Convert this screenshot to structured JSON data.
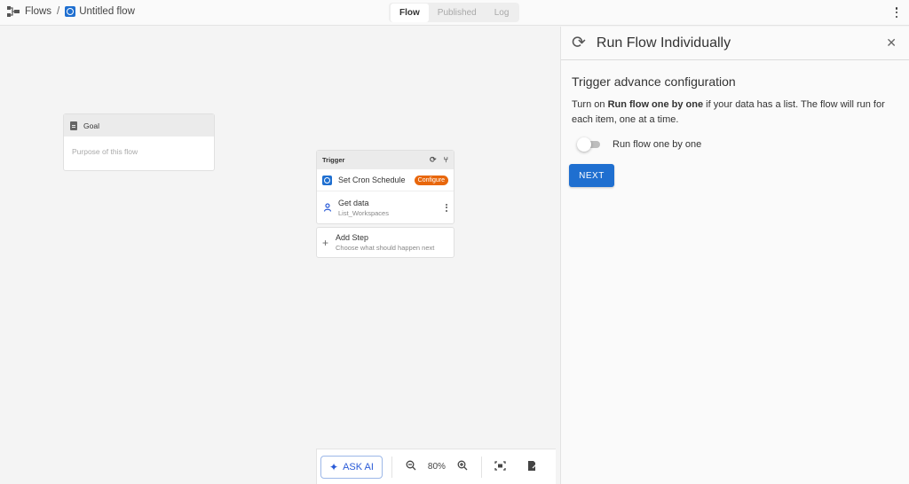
{
  "breadcrumb": {
    "root": "Flows",
    "separator": "/",
    "current": "Untitled flow"
  },
  "tabs": [
    {
      "label": "Flow",
      "active": true
    },
    {
      "label": "Published",
      "active": false
    },
    {
      "label": "Log",
      "active": false
    }
  ],
  "canvas": {
    "goal": {
      "title": "Goal",
      "placeholder": "Purpose of this flow"
    },
    "trigger": {
      "title": "Trigger",
      "steps": [
        {
          "label": "Set Cron Schedule",
          "badge": "Configure"
        },
        {
          "label": "Get data",
          "sublabel": "List_Workspaces"
        }
      ]
    },
    "add_step": {
      "label": "Add Step",
      "sublabel": "Choose what should happen next"
    }
  },
  "toolbar": {
    "ask_ai": "ASK AI",
    "zoom": "80%"
  },
  "panel": {
    "title": "Run Flow Individually",
    "heading": "Trigger advance configuration",
    "desc_prefix": "Turn on ",
    "desc_bold": "Run flow one by one",
    "desc_suffix": " if your data has a list. The flow will run for each item, one at a time.",
    "toggle_label": "Run flow one by one",
    "toggle_on": false,
    "next_label": "NEXT"
  },
  "colors": {
    "accent": "#1f6fd0",
    "configure_badge": "#e8670c"
  }
}
